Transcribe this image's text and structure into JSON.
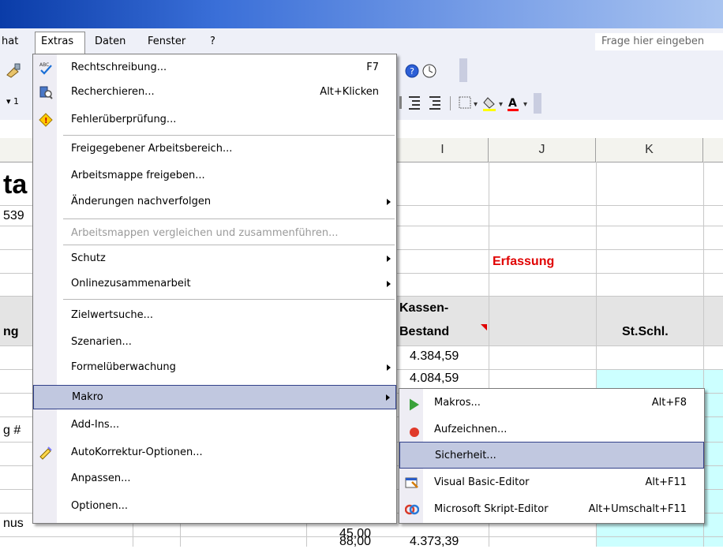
{
  "menubar": {
    "items": [
      "hat",
      "Extras",
      "Daten",
      "Fenster",
      "?"
    ],
    "ask_placeholder": "Frage hier eingeben"
  },
  "colors": {
    "menu_highlight": "#c1c8e0",
    "highlight_border": "#32418a",
    "erfassung_red": "#e00000",
    "cyan_cells": "#ccffff",
    "titlebar": "#0a3ca8"
  },
  "columns": {
    "i": "I",
    "j": "J",
    "k": "K"
  },
  "sheet": {
    "title_partial": "ta",
    "num_partial": "539",
    "erfassung": "Erfassung",
    "kassen": "Kassen-",
    "bestand": "Bestand",
    "stschl": "St.Schl.",
    "ng": "ng",
    "g_hash": "g #",
    "nus": "nus",
    "val1": "4.384,59",
    "val2": "4.084,59",
    "val3": "4.373,39",
    "val_left1": "45,00",
    "val_left2": "88,00"
  },
  "menu": {
    "items": [
      {
        "label": "Rechtschreibung...",
        "shortcut": "F7",
        "icon": "spellcheck-icon"
      },
      {
        "label": "Recherchieren...",
        "shortcut": "Alt+Klicken",
        "icon": "research-icon"
      },
      {
        "label": "Fehlerüberprüfung...",
        "shortcut": "",
        "icon": "error-check-icon"
      },
      {
        "label": "Freigegebener Arbeitsbereich...",
        "shortcut": ""
      },
      {
        "label": "Arbeitsmappe freigeben...",
        "shortcut": ""
      },
      {
        "label": "Änderungen nachverfolgen",
        "shortcut": "",
        "submenu": true
      },
      {
        "label": "Arbeitsmappen vergleichen und zusammenführen...",
        "shortcut": "",
        "disabled": true
      },
      {
        "label": "Schutz",
        "shortcut": "",
        "submenu": true
      },
      {
        "label": "Onlinezusammenarbeit",
        "shortcut": "",
        "submenu": true
      },
      {
        "label": "Zielwertsuche...",
        "shortcut": ""
      },
      {
        "label": "Szenarien...",
        "shortcut": ""
      },
      {
        "label": "Formelüberwachung",
        "shortcut": "",
        "submenu": true
      },
      {
        "label": "Makro",
        "shortcut": "",
        "submenu": true,
        "highlighted": true
      },
      {
        "label": "Add-Ins...",
        "shortcut": ""
      },
      {
        "label": "AutoKorrektur-Optionen...",
        "shortcut": "",
        "icon": "autocorrect-icon"
      },
      {
        "label": "Anpassen...",
        "shortcut": ""
      },
      {
        "label": "Optionen...",
        "shortcut": ""
      }
    ]
  },
  "submenu": {
    "items": [
      {
        "label": "Makros...",
        "shortcut": "Alt+F8",
        "icon": "play-icon"
      },
      {
        "label": "Aufzeichnen...",
        "shortcut": "",
        "icon": "record-icon"
      },
      {
        "label": "Sicherheit...",
        "shortcut": "",
        "highlighted": true
      },
      {
        "label": "Visual Basic-Editor",
        "shortcut": "Alt+F11",
        "icon": "vb-editor-icon"
      },
      {
        "label": "Microsoft Skript-Editor",
        "shortcut": "Alt+Umschalt+F11",
        "icon": "script-editor-icon"
      }
    ]
  }
}
